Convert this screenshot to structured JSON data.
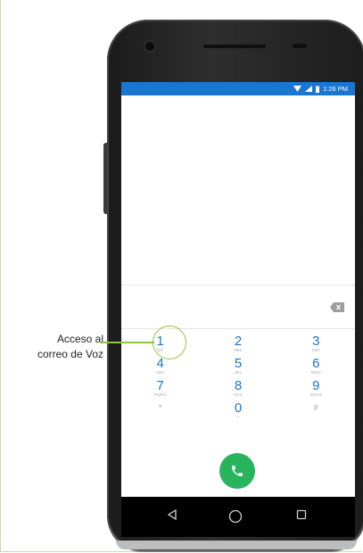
{
  "annotation": {
    "line1": "Acceso al",
    "line2": "correo de Voz",
    "highlight_color": "#8dc63f"
  },
  "status_bar": {
    "time": "1:26 PM",
    "background_color": "#1976d2",
    "icons": [
      "wifi-icon",
      "signal-icon",
      "battery-icon"
    ]
  },
  "dial_field": {
    "value": "",
    "icon": "backspace-icon"
  },
  "dialpad": {
    "accent_color": "#1976d2",
    "keys": [
      {
        "digit": "1",
        "letters": "QO"
      },
      {
        "digit": "2",
        "letters": "ABC"
      },
      {
        "digit": "3",
        "letters": "DEF"
      },
      {
        "digit": "4",
        "letters": "GHI"
      },
      {
        "digit": "5",
        "letters": "JKL"
      },
      {
        "digit": "6",
        "letters": "MNO"
      },
      {
        "digit": "7",
        "letters": "PQRS"
      },
      {
        "digit": "8",
        "letters": "TUV"
      },
      {
        "digit": "9",
        "letters": "WXYZ"
      },
      {
        "digit": "*",
        "letters": ""
      },
      {
        "digit": "0",
        "letters": "+"
      },
      {
        "digit": "#",
        "letters": ""
      }
    ]
  },
  "call_button": {
    "icon": "phone-icon",
    "color": "#27b45c"
  },
  "nav_bar": {
    "icons": [
      "back-icon",
      "home-icon",
      "recent-apps-icon"
    ]
  }
}
